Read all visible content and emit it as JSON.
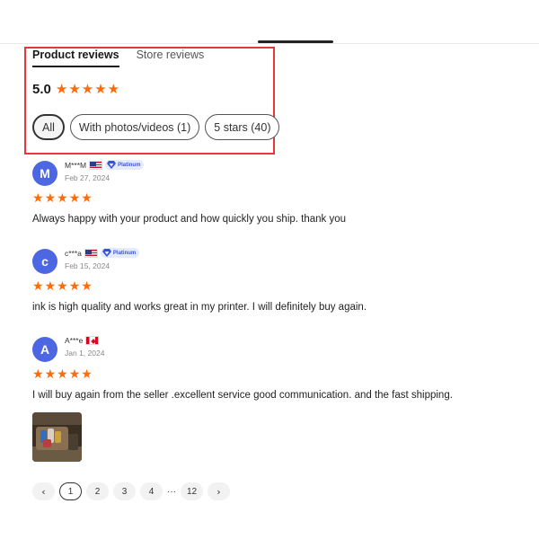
{
  "tabs": [
    {
      "label": "Product reviews",
      "active": true
    },
    {
      "label": "Store reviews",
      "active": false
    }
  ],
  "summary": {
    "rating": "5.0",
    "stars": 5
  },
  "filters": [
    {
      "label": "All",
      "selected": true
    },
    {
      "label": "With photos/videos (1)",
      "selected": false
    },
    {
      "label": "5 stars (40)",
      "selected": false
    }
  ],
  "reviews": [
    {
      "initial": "M",
      "name": "M***M",
      "flag": "us-flag-icon",
      "badge": "Platinum",
      "date": "Feb 27, 2024",
      "stars": 5,
      "text": "Always happy with your product and how quickly you ship. thank you"
    },
    {
      "initial": "c",
      "name": "c***a",
      "flag": "us-flag-icon",
      "badge": "Platinum",
      "date": "Feb 15, 2024",
      "stars": 5,
      "text": "ink is high quality and works great in my printer. I will definitely buy again."
    },
    {
      "initial": "A",
      "name": "A***e",
      "flag": "ca-flag-icon",
      "badge": "",
      "date": "Jan 1, 2024",
      "stars": 5,
      "text": "I will buy again from the seller .excellent service good communication. and the fast shipping.",
      "has_photo": true
    }
  ],
  "pagination": {
    "prev": "‹",
    "pages": [
      "1",
      "2",
      "3",
      "4"
    ],
    "ellipsis": "···",
    "last": "12",
    "next": "›",
    "current": "1"
  },
  "colors": {
    "star": "#fd6c0a",
    "avatar": "#4c67e1",
    "highlight": "#e4393c",
    "badge_bg": "#e6eafe",
    "badge_text": "#3654d6"
  }
}
